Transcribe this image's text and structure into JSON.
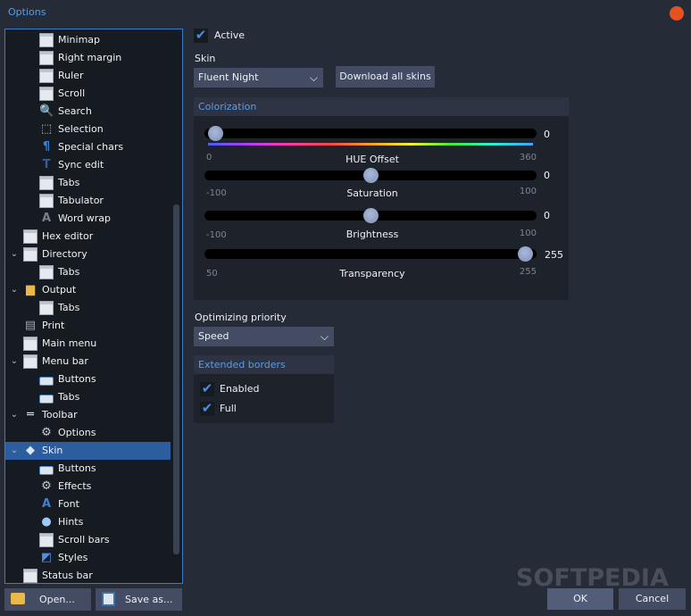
{
  "window": {
    "title": "Options",
    "close_color": "#e5521f"
  },
  "tree": {
    "items": [
      {
        "label": "Minimap",
        "icon": "minimap-icon",
        "level": 2,
        "expanded": null
      },
      {
        "label": "Right margin",
        "icon": "right-margin-icon",
        "level": 2,
        "expanded": null
      },
      {
        "label": "Ruler",
        "icon": "ruler-icon",
        "level": 2,
        "expanded": null
      },
      {
        "label": "Scroll",
        "icon": "scroll-icon",
        "level": 2,
        "expanded": null
      },
      {
        "label": "Search",
        "icon": "search-icon",
        "level": 2,
        "expanded": null
      },
      {
        "label": "Selection",
        "icon": "selection-icon",
        "level": 2,
        "expanded": null
      },
      {
        "label": "Special chars",
        "icon": "pilcrow-icon",
        "level": 2,
        "expanded": null
      },
      {
        "label": "Sync edit",
        "icon": "sync-edit-icon",
        "level": 2,
        "expanded": null
      },
      {
        "label": "Tabs",
        "icon": "tabs-icon",
        "level": 2,
        "expanded": null
      },
      {
        "label": "Tabulator",
        "icon": "tabulator-icon",
        "level": 2,
        "expanded": null
      },
      {
        "label": "Word wrap",
        "icon": "word-wrap-icon",
        "level": 2,
        "expanded": null
      },
      {
        "label": "Hex editor",
        "icon": "hex-editor-icon",
        "level": 1,
        "expanded": null
      },
      {
        "label": "Directory",
        "icon": "directory-icon",
        "level": 1,
        "expanded": true
      },
      {
        "label": "Tabs",
        "icon": "tabs-icon",
        "level": 2,
        "expanded": null
      },
      {
        "label": "Output",
        "icon": "output-folder-icon",
        "level": 1,
        "expanded": true
      },
      {
        "label": "Tabs",
        "icon": "tabs-icon",
        "level": 2,
        "expanded": null
      },
      {
        "label": "Print",
        "icon": "printer-icon",
        "level": 1,
        "expanded": null
      },
      {
        "label": "Main menu",
        "icon": "main-menu-icon",
        "level": 1,
        "expanded": null
      },
      {
        "label": "Menu bar",
        "icon": "menu-bar-icon",
        "level": 1,
        "expanded": true
      },
      {
        "label": "Buttons",
        "icon": "buttons-icon",
        "level": 2,
        "expanded": null
      },
      {
        "label": "Tabs",
        "icon": "tab-shape-icon",
        "level": 2,
        "expanded": null
      },
      {
        "label": "Toolbar",
        "icon": "toolbar-icon",
        "level": 1,
        "expanded": true
      },
      {
        "label": "Options",
        "icon": "gear-icon",
        "level": 2,
        "expanded": null
      },
      {
        "label": "Skin",
        "icon": "skin-palette-icon",
        "level": 1,
        "expanded": true,
        "selected": true
      },
      {
        "label": "Buttons",
        "icon": "buttons-icon",
        "level": 2,
        "expanded": null
      },
      {
        "label": "Effects",
        "icon": "gear-icon",
        "level": 2,
        "expanded": null
      },
      {
        "label": "Font",
        "icon": "font-icon",
        "level": 2,
        "expanded": null
      },
      {
        "label": "Hints",
        "icon": "speech-bubble-icon",
        "level": 2,
        "expanded": null
      },
      {
        "label": "Scroll bars",
        "icon": "scroll-bars-icon",
        "level": 2,
        "expanded": null
      },
      {
        "label": "Styles",
        "icon": "styles-brush-icon",
        "level": 2,
        "expanded": null
      },
      {
        "label": "Status bar",
        "icon": "status-bar-icon",
        "level": 1,
        "expanded": null
      }
    ]
  },
  "bottom_left": {
    "open_label": "Open...",
    "save_as_label": "Save as..."
  },
  "skin": {
    "active_label": "Active",
    "active_checked": true,
    "skin_label": "Skin",
    "skin_value": "Fluent Night",
    "download_label": "Download all skins"
  },
  "colorization": {
    "title": "Colorization",
    "sliders": [
      {
        "caption": "HUE Offset",
        "min": "0",
        "max": "360",
        "value": "0",
        "fraction": 0.0,
        "rainbow": true
      },
      {
        "caption": "Saturation",
        "min": "-100",
        "max": "100",
        "value": "0",
        "fraction": 0.5,
        "rainbow": false
      },
      {
        "caption": "Brightness",
        "min": "-100",
        "max": "100",
        "value": "0",
        "fraction": 0.5,
        "rainbow": false
      },
      {
        "caption": "Transparency",
        "min": "50",
        "max": "255",
        "value": "255",
        "fraction": 1.0,
        "rainbow": false
      }
    ]
  },
  "optimizing": {
    "label": "Optimizing priority",
    "value": "Speed"
  },
  "extended_borders": {
    "title": "Extended borders",
    "enabled_label": "Enabled",
    "enabled_checked": true,
    "full_label": "Full",
    "full_checked": true
  },
  "footer": {
    "ok_label": "OK",
    "cancel_label": "Cancel",
    "watermark": "SOFTPEDIA"
  },
  "checkmark": "✔",
  "caret": "⌄",
  "chevron": "⌄"
}
